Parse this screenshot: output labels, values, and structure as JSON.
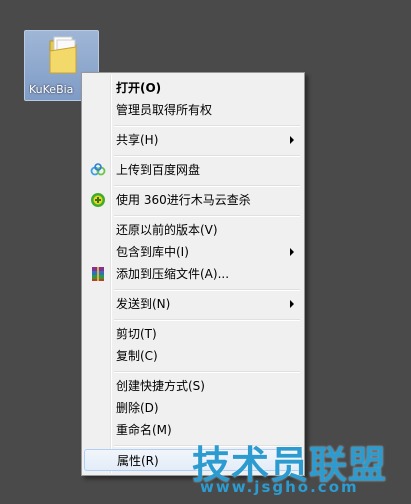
{
  "desktop": {
    "icon_label": "KuKeBia",
    "icon_name": "folder-icon"
  },
  "context_menu": {
    "items": [
      {
        "label": "打开(O)"
      },
      {
        "label": "管理员取得所有权"
      },
      {
        "label": "共享(H)"
      },
      {
        "label": "上传到百度网盘",
        "icon": "baidu-netdisk-icon"
      },
      {
        "label": "使用 360进行木马云查杀",
        "icon": "360-security-icon"
      },
      {
        "label": "还原以前的版本(V)"
      },
      {
        "label": "包含到库中(I)"
      },
      {
        "label": "添加到压缩文件(A)...",
        "icon": "winrar-icon"
      },
      {
        "label": "发送到(N)"
      },
      {
        "label": "剪切(T)"
      },
      {
        "label": "复制(C)"
      },
      {
        "label": "创建快捷方式(S)"
      },
      {
        "label": "删除(D)"
      },
      {
        "label": "重命名(M)"
      },
      {
        "label": "属性(R)"
      }
    ]
  },
  "watermark": {
    "title": "技术员联盟",
    "url": "www.jsgho.com"
  },
  "colors": {
    "menu_background": "#f0f0f0",
    "hover_border": "#aecff7",
    "watermark": "#2c9bd0"
  }
}
